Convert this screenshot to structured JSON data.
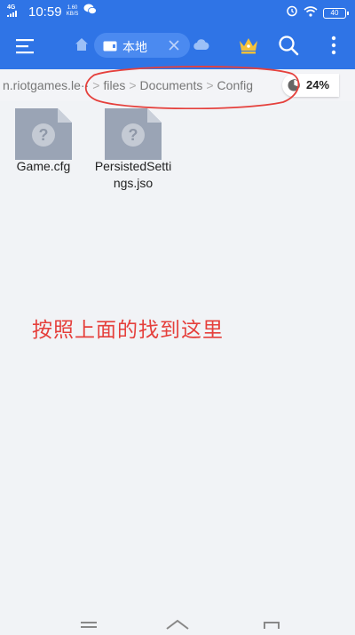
{
  "status_bar": {
    "signal": "4G",
    "time": "10:59",
    "speed_value": "1.60",
    "speed_unit": "KB/S",
    "battery": "40",
    "icons": [
      "signal-icon",
      "wechat-icon",
      "alarm-icon",
      "wifi-icon",
      "battery-icon"
    ]
  },
  "app_bar": {
    "menu_icon": "menu-icon",
    "home_icon": "home-icon",
    "tab_label": "本地",
    "close_icon": "close-icon",
    "cloud_icon": "cloud-icon",
    "crown_icon": "crown-icon",
    "search_icon": "search-icon",
    "more_icon": "more-vert-icon"
  },
  "breadcrumb": {
    "items": [
      "n.riotgames.le··",
      "files",
      "Documents",
      "Config"
    ],
    "storage_percent": "24%"
  },
  "files": [
    {
      "name": "Game.cfg",
      "icon": "unknown-file-icon"
    },
    {
      "name": "PersistedSettings.jso",
      "icon": "unknown-file-icon"
    }
  ],
  "annotation_text": "按照上面的找到这里",
  "colors": {
    "primary": "#2f74e6",
    "tab_bg": "#4b8af0",
    "background": "#f1f3f6",
    "annotation_red": "#e5403c",
    "crown_gold": "#f3c13a",
    "file_icon": "#9aa4b5"
  }
}
